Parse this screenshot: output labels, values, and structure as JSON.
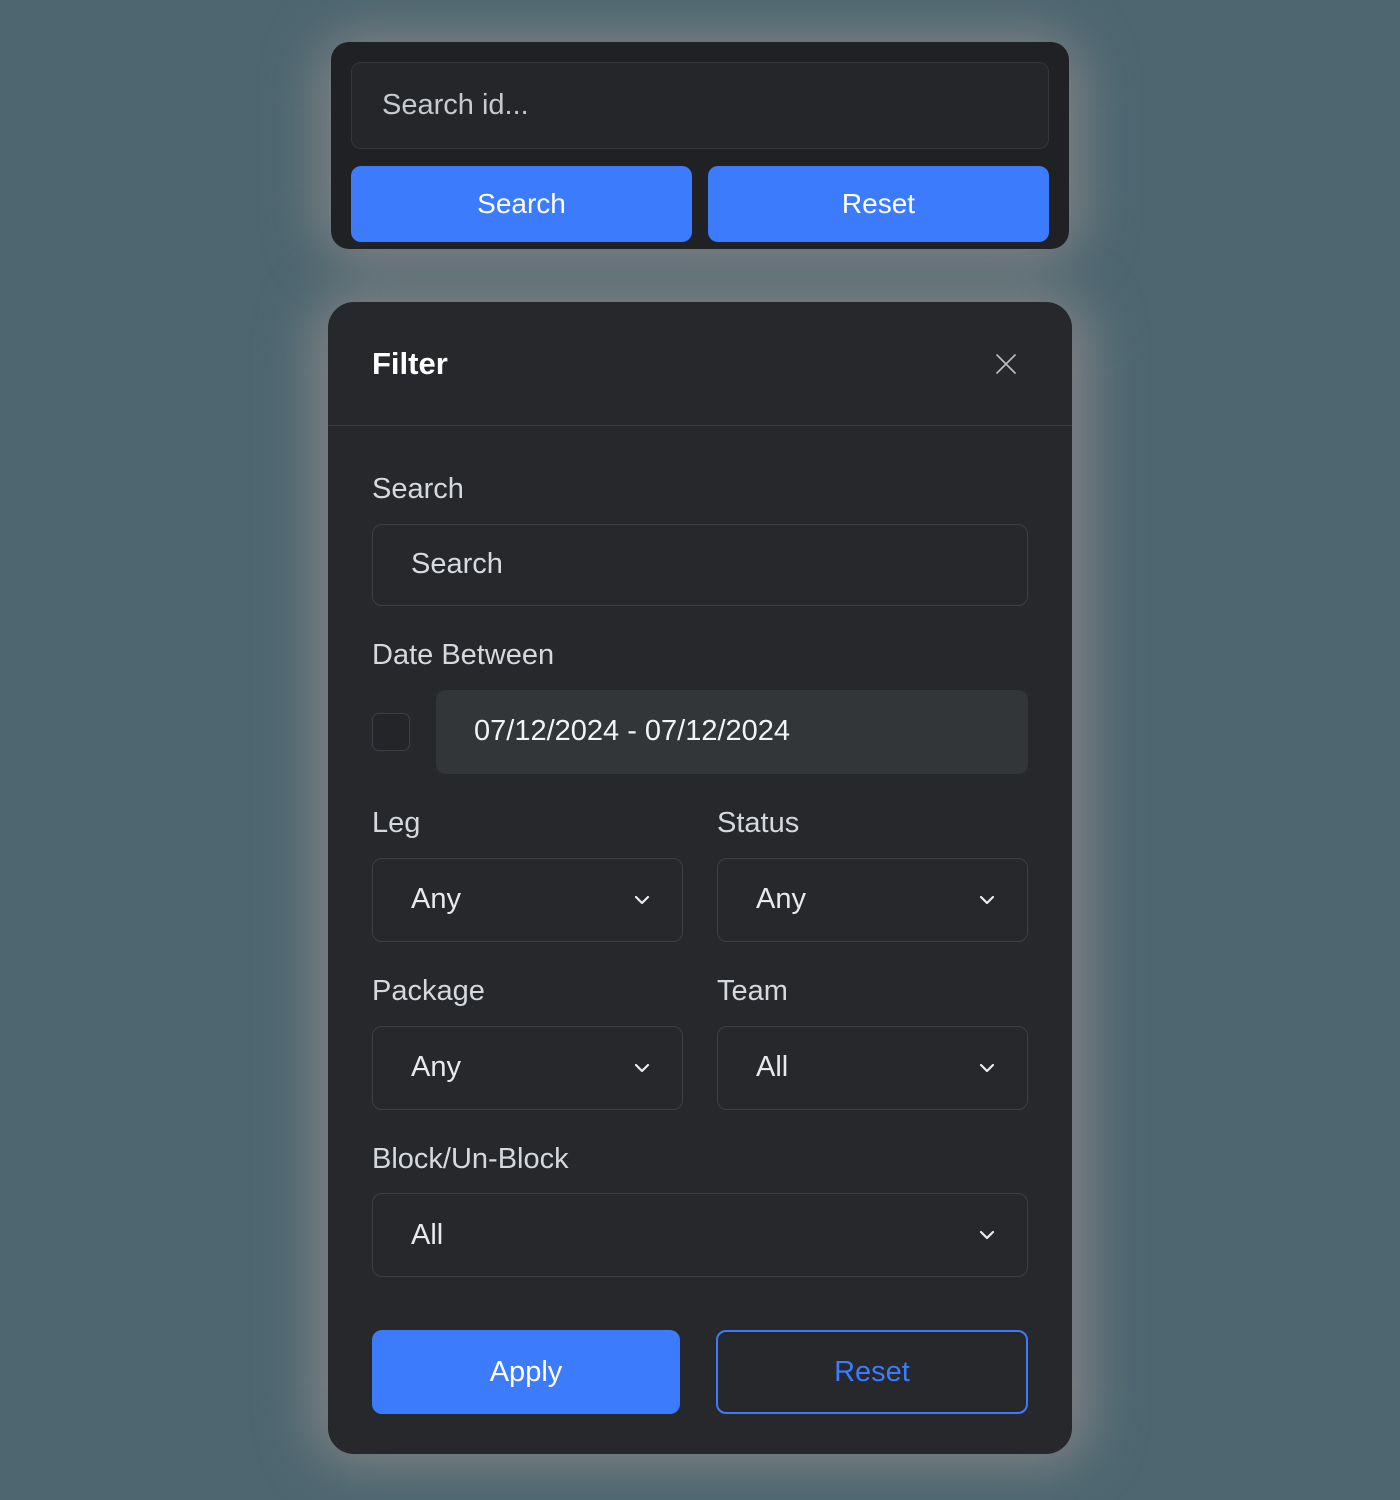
{
  "colors": {
    "page_background": "#4d6670",
    "glow": "#808285",
    "panel_background": "#26282b",
    "search_panel_background": "#1f2124",
    "accent_blue": "#3d7bfd",
    "label_text": "#d5d8dc",
    "title_text": "#ffffff"
  },
  "search_panel": {
    "search_id_value": "",
    "search_id_placeholder": "Search id...",
    "search_button_label": "Search",
    "reset_button_label": "Reset"
  },
  "filter_panel": {
    "title": "Filter",
    "close_icon": "close-icon",
    "search": {
      "label": "Search",
      "value": "",
      "placeholder": "Search"
    },
    "date_between": {
      "label": "Date Between",
      "checkbox_checked": false,
      "value": "07/12/2024 - 07/12/2024"
    },
    "leg": {
      "label": "Leg",
      "selected": "Any",
      "chevron_icon": "chevron-down-icon"
    },
    "status": {
      "label": "Status",
      "selected": "Any",
      "chevron_icon": "chevron-down-icon"
    },
    "package": {
      "label": "Package",
      "selected": "Any",
      "chevron_icon": "chevron-down-icon"
    },
    "team": {
      "label": "Team",
      "selected": "All",
      "chevron_icon": "chevron-down-icon"
    },
    "block_unblock": {
      "label": "Block/Un-Block",
      "selected": "All",
      "chevron_icon": "chevron-down-icon"
    },
    "footer": {
      "apply_label": "Apply",
      "reset_label": "Reset"
    }
  }
}
